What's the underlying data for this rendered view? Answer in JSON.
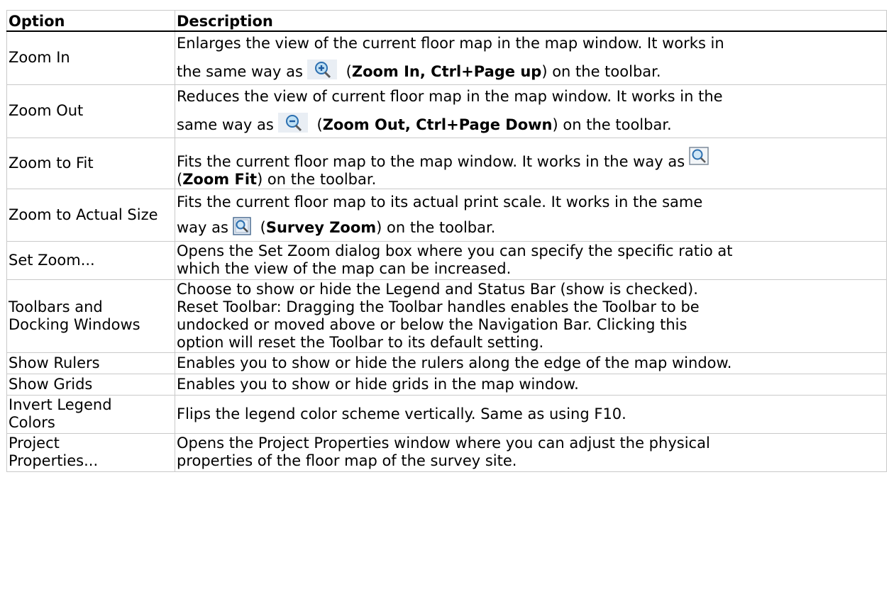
{
  "header": {
    "option": "Option",
    "description": "Description"
  },
  "rows": [
    {
      "option": "Zoom In",
      "d1": "Enlarges the view of the current floor map in the map window. It works in",
      "d2a": "the same way as",
      "icon": "zoom-in-icon",
      "d2b": " (",
      "bold": "Zoom In, Ctrl+Page up",
      "d2c": ") on the toolbar."
    },
    {
      "option": "Zoom Out",
      "d1": "Reduces the view of current floor map in the map window. It works in the",
      "d2a": "same way as",
      "icon": "zoom-out-icon",
      "d2b": " (",
      "bold": "Zoom Out, Ctrl+Page Down",
      "d2c": ") on the toolbar."
    },
    {
      "option": "Zoom to Fit",
      "d1": "Fits the current floor map to the map window. It works in the way as",
      "icon": "zoom-fit-icon",
      "d2a": "(",
      "bold": "Zoom Fit",
      "d2c": ") on the toolbar."
    },
    {
      "option": "Zoom to Actual Size",
      "d1": "Fits the current floor map to its actual print scale. It works in the same",
      "d2a": "way as",
      "icon": "survey-zoom-icon",
      "d2b": " (",
      "bold": "Survey Zoom",
      "d2c": ") on the toolbar."
    },
    {
      "option": "Set Zoom...",
      "d1": "Opens the Set Zoom dialog box where you can specify the specific ratio at",
      "d2": "which the view of the map can be increased."
    },
    {
      "option": "Toolbars and Docking Windows",
      "d1": "Choose to show or hide the Legend and Status Bar (show is checked).",
      "d2": "Reset Toolbar: Dragging the Toolbar handles enables the Toolbar to be",
      "d3": "undocked or moved above or below the Navigation Bar. Clicking this",
      "d4": "option will reset the Toolbar to its default setting."
    },
    {
      "option": "Show Rulers",
      "d1": "Enables you to show or hide the rulers along the edge of the map window."
    },
    {
      "option": "Show Grids",
      "d1": "Enables you to show or hide grids in the map window."
    },
    {
      "option": "Invert Legend Colors",
      "d1": "Flips the legend color scheme vertically. Same as using F10."
    },
    {
      "option": "Project Properties...",
      "d1": "Opens the Project Properties window where you can adjust the physical",
      "d2": "properties of the floor map of the survey site."
    }
  ]
}
